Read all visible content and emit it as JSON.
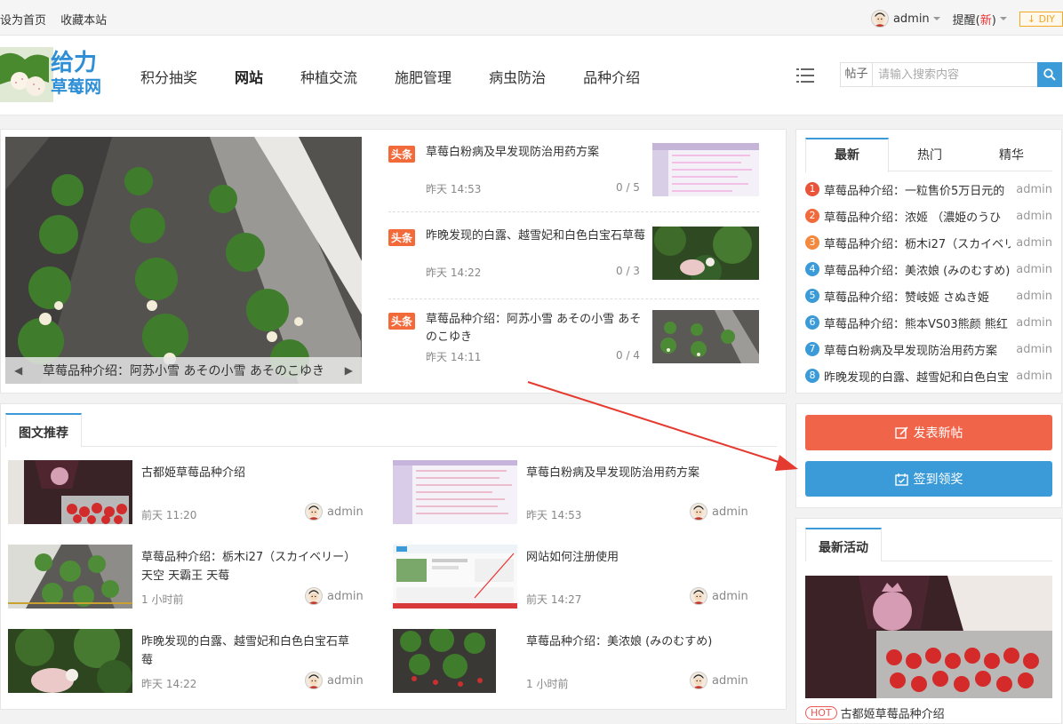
{
  "topbar": {
    "set_home": "设为首页",
    "bookmark": "收藏本站",
    "username": "admin",
    "remind_prefix": "提醒(",
    "remind_new": "新",
    "remind_suffix": ")",
    "diy": "DIY"
  },
  "header": {
    "logo_line1": "给力",
    "logo_line2": "草莓网",
    "nav": [
      "积分抽奖",
      "网站",
      "种植交流",
      "施肥管理",
      "病虫防治",
      "品种介绍"
    ],
    "nav_active": "网站",
    "search_scope": "帖子",
    "search_placeholder": "请输入搜索内容"
  },
  "slider": {
    "caption": "草莓品种介绍：阿苏小雪 あその小雪 あそのこゆき"
  },
  "headlines": [
    {
      "tag": "头条",
      "title": "草莓白粉病及早发现防治用药方案",
      "time": "昨天 14:53",
      "count": "0 / 5"
    },
    {
      "tag": "头条",
      "title": "昨晚发现的白露、越雪妃和白色白宝石草莓",
      "time": "昨天 14:22",
      "count": "0 / 3"
    },
    {
      "tag": "头条",
      "title": "草莓品种介绍：阿苏小雪 あその小雪 あそのこゆき",
      "time": "昨天 14:11",
      "count": "0 / 4"
    }
  ],
  "recommend": {
    "title": "图文推荐",
    "items": [
      {
        "title": "古都姫草莓品种介绍",
        "time": "前天 11:20",
        "author": "admin"
      },
      {
        "title": "草莓白粉病及早发现防治用药方案",
        "time": "昨天 14:53",
        "author": "admin"
      },
      {
        "title": "草莓品种介绍：栃木i27（スカイベリー）天空 天霸王 天莓",
        "time": "1 小时前",
        "author": "admin"
      },
      {
        "title": "网站如何注册使用",
        "time": "前天 14:27",
        "author": "admin"
      },
      {
        "title": "昨晚发现的白露、越雪妃和白色白宝石草莓",
        "time": "昨天 14:22",
        "author": "admin"
      },
      {
        "title": "草莓品种介绍：美浓娘 (みのむすめ)",
        "time": "1 小时前",
        "author": "admin"
      }
    ]
  },
  "sidebar": {
    "tabs": [
      "最新",
      "热门",
      "精华"
    ],
    "active_tab": "最新",
    "list": [
      {
        "num": "1",
        "title": "草莓品种介绍：一粒售价5万日元的",
        "author": "admin",
        "color": "#e8533a"
      },
      {
        "num": "2",
        "title": "草莓品种介绍：浓姬 （濃姫のうひ",
        "author": "admin",
        "color": "#f06a3c"
      },
      {
        "num": "3",
        "title": "草莓品种介绍：枥木i27（スカイベリ",
        "author": "admin",
        "color": "#f4893e"
      },
      {
        "num": "4",
        "title": "草莓品种介绍：美浓娘 (みのむすめ)",
        "author": "admin",
        "color": "#3a9bd8"
      },
      {
        "num": "5",
        "title": "草莓品种介绍：赞岐姬 さぬき姫",
        "author": "admin",
        "color": "#3a9bd8"
      },
      {
        "num": "6",
        "title": "草莓品种介绍：熊本VS03熊颜 熊红",
        "author": "admin",
        "color": "#3a9bd8"
      },
      {
        "num": "7",
        "title": "草莓白粉病及早发现防治用药方案",
        "author": "admin",
        "color": "#3a9bd8"
      },
      {
        "num": "8",
        "title": "昨晚发现的白露、越雪妃和白色白宝",
        "author": "admin",
        "color": "#3a9bd8"
      }
    ],
    "post_button": "发表新帖",
    "checkin_button": "签到领奖",
    "activity_title": "最新活动",
    "activity_hot": "HOT",
    "activity_caption": "古都姬草莓品种介绍"
  },
  "colors": {
    "accent_blue": "#3a9bd8",
    "post_orange": "#f0654a",
    "checkin_blue": "#3a9bd8",
    "headline_tag": "#f26a3a"
  }
}
